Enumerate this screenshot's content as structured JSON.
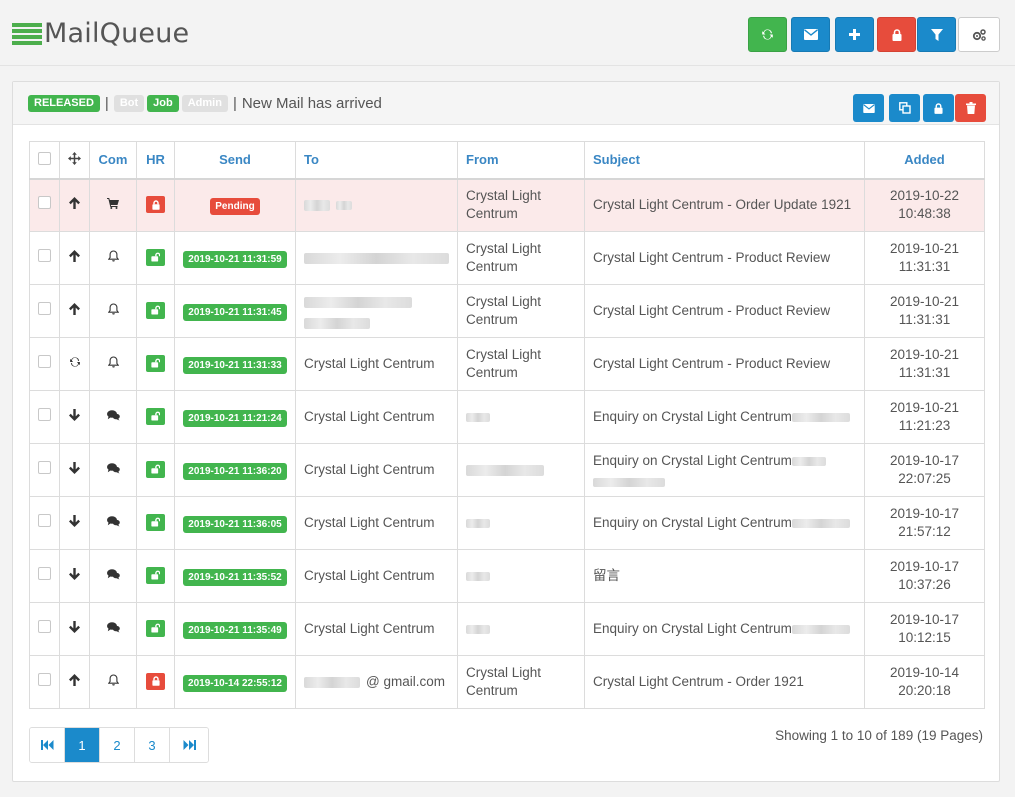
{
  "app": {
    "title": "MailQueue"
  },
  "toolbar": {
    "buttons": [
      {
        "icon": "refresh-icon",
        "color": "#42b54e"
      },
      {
        "icon": "envelope-icon",
        "color": "#1b8acb"
      },
      {
        "icon": "plus-icon",
        "color": "#1b8acb"
      },
      {
        "icon": "lock-icon",
        "color": "#e74c3c"
      },
      {
        "icon": "filter-icon",
        "color": "#1b8acb"
      },
      {
        "icon": "gears-icon",
        "color": "#ffffff"
      }
    ]
  },
  "panel": {
    "tags": {
      "released": "RELEASED",
      "bot": "Bot",
      "job": "Job",
      "admin": "Admin"
    },
    "message": "New Mail has arrived",
    "buttons": [
      "envelope-icon",
      "copy-icon",
      "lock-icon",
      "trash-icon"
    ]
  },
  "table": {
    "headers": {
      "move": "",
      "com": "Com",
      "hr": "HR",
      "send": "Send",
      "to": "To",
      "from": "From",
      "subject": "Subject",
      "added": "Added"
    },
    "rows": [
      {
        "dir": "arrow-up",
        "com": "cart",
        "lock": "locked",
        "send": "Pending",
        "send_status": "pending",
        "to": "",
        "to_blur": "short",
        "from1": "Crystal Light",
        "from2": "Centrum",
        "from_blur": "",
        "subject": "Crystal Light Centrum - Order Update 1921",
        "added_date": "2019-10-22",
        "added_time": "10:48:38"
      },
      {
        "dir": "arrow-up",
        "com": "bell",
        "lock": "unlocked",
        "send": "2019-10-21 11:31:59",
        "send_status": "sent",
        "to": "",
        "to_blur": "long",
        "from1": "Crystal Light",
        "from2": "Centrum",
        "from_blur": "",
        "subject": "Crystal Light Centrum - Product Review",
        "added_date": "2019-10-21",
        "added_time": "11:31:31"
      },
      {
        "dir": "arrow-up",
        "com": "bell",
        "lock": "unlocked",
        "send": "2019-10-21 11:31:45",
        "send_status": "sent",
        "to": "",
        "to_blur": "double",
        "from1": "Crystal Light",
        "from2": "Centrum",
        "from_blur": "",
        "subject": "Crystal Light Centrum - Product Review",
        "added_date": "2019-10-21",
        "added_time": "11:31:31"
      },
      {
        "dir": "refresh",
        "com": "bell",
        "lock": "unlocked",
        "send": "2019-10-21 11:31:33",
        "send_status": "sent",
        "to": "Crystal Light Centrum",
        "to_blur": "",
        "from1": "Crystal Light",
        "from2": "Centrum",
        "from_blur": "",
        "subject": "Crystal Light Centrum - Product Review",
        "added_date": "2019-10-21",
        "added_time": "11:31:31"
      },
      {
        "dir": "arrow-down",
        "com": "comments",
        "lock": "unlocked",
        "send": "2019-10-21 11:21:24",
        "send_status": "sent",
        "to": "Crystal Light Centrum",
        "to_blur": "",
        "from1": "",
        "from2": "",
        "from_blur": "xs",
        "subject": "Enquiry on Crystal Light Centrum",
        "subject_blur": "a",
        "added_date": "2019-10-21",
        "added_time": "11:21:23"
      },
      {
        "dir": "arrow-down",
        "com": "comments",
        "lock": "unlocked",
        "send": "2019-10-21 11:36:20",
        "send_status": "sent",
        "to": "Crystal Light Centrum",
        "to_blur": "",
        "from1": "",
        "from2": "",
        "from_blur": "lg",
        "subject": "Enquiry on Crystal Light Centrum",
        "subject_blur": "b",
        "added_date": "2019-10-17",
        "added_time": "22:07:25"
      },
      {
        "dir": "arrow-down",
        "com": "comments",
        "lock": "unlocked",
        "send": "2019-10-21 11:36:05",
        "send_status": "sent",
        "to": "Crystal Light Centrum",
        "to_blur": "",
        "from1": "",
        "from2": "",
        "from_blur": "xs",
        "subject": "Enquiry on Crystal Light Centrum",
        "subject_blur": "a",
        "added_date": "2019-10-17",
        "added_time": "21:57:12"
      },
      {
        "dir": "arrow-down",
        "com": "comments",
        "lock": "unlocked",
        "send": "2019-10-21 11:35:52",
        "send_status": "sent",
        "to": "Crystal Light Centrum",
        "to_blur": "",
        "from1": "",
        "from2": "",
        "from_blur": "xs",
        "subject": "留言",
        "subject_blur": "",
        "added_date": "2019-10-17",
        "added_time": "10:37:26"
      },
      {
        "dir": "arrow-down",
        "com": "comments",
        "lock": "unlocked",
        "send": "2019-10-21 11:35:49",
        "send_status": "sent",
        "to": "Crystal Light Centrum",
        "to_blur": "",
        "from1": "",
        "from2": "",
        "from_blur": "xs",
        "subject": "Enquiry on Crystal Light Centrum",
        "subject_blur": "a",
        "added_date": "2019-10-17",
        "added_time": "10:12:15"
      },
      {
        "dir": "arrow-up",
        "com": "bell",
        "lock": "locked",
        "send": "2019-10-14 22:55:12",
        "send_status": "sent",
        "to": "@ gmail.com",
        "to_blur": "prefix",
        "from1": "Crystal Light",
        "from2": "Centrum",
        "from_blur": "",
        "subject": "Crystal Light Centrum - Order 1921",
        "added_date": "2019-10-14",
        "added_time": "20:20:18"
      }
    ]
  },
  "pagination": {
    "pages": [
      "1",
      "2",
      "3"
    ],
    "active": "1",
    "summary": "Showing 1 to 10 of 189 (19 Pages)"
  },
  "colors": {
    "green": "#42b54e",
    "blue": "#1b8acb",
    "red": "#e74c3c",
    "header_text": "#3a87c4",
    "pending_row": "#fbeaea"
  }
}
